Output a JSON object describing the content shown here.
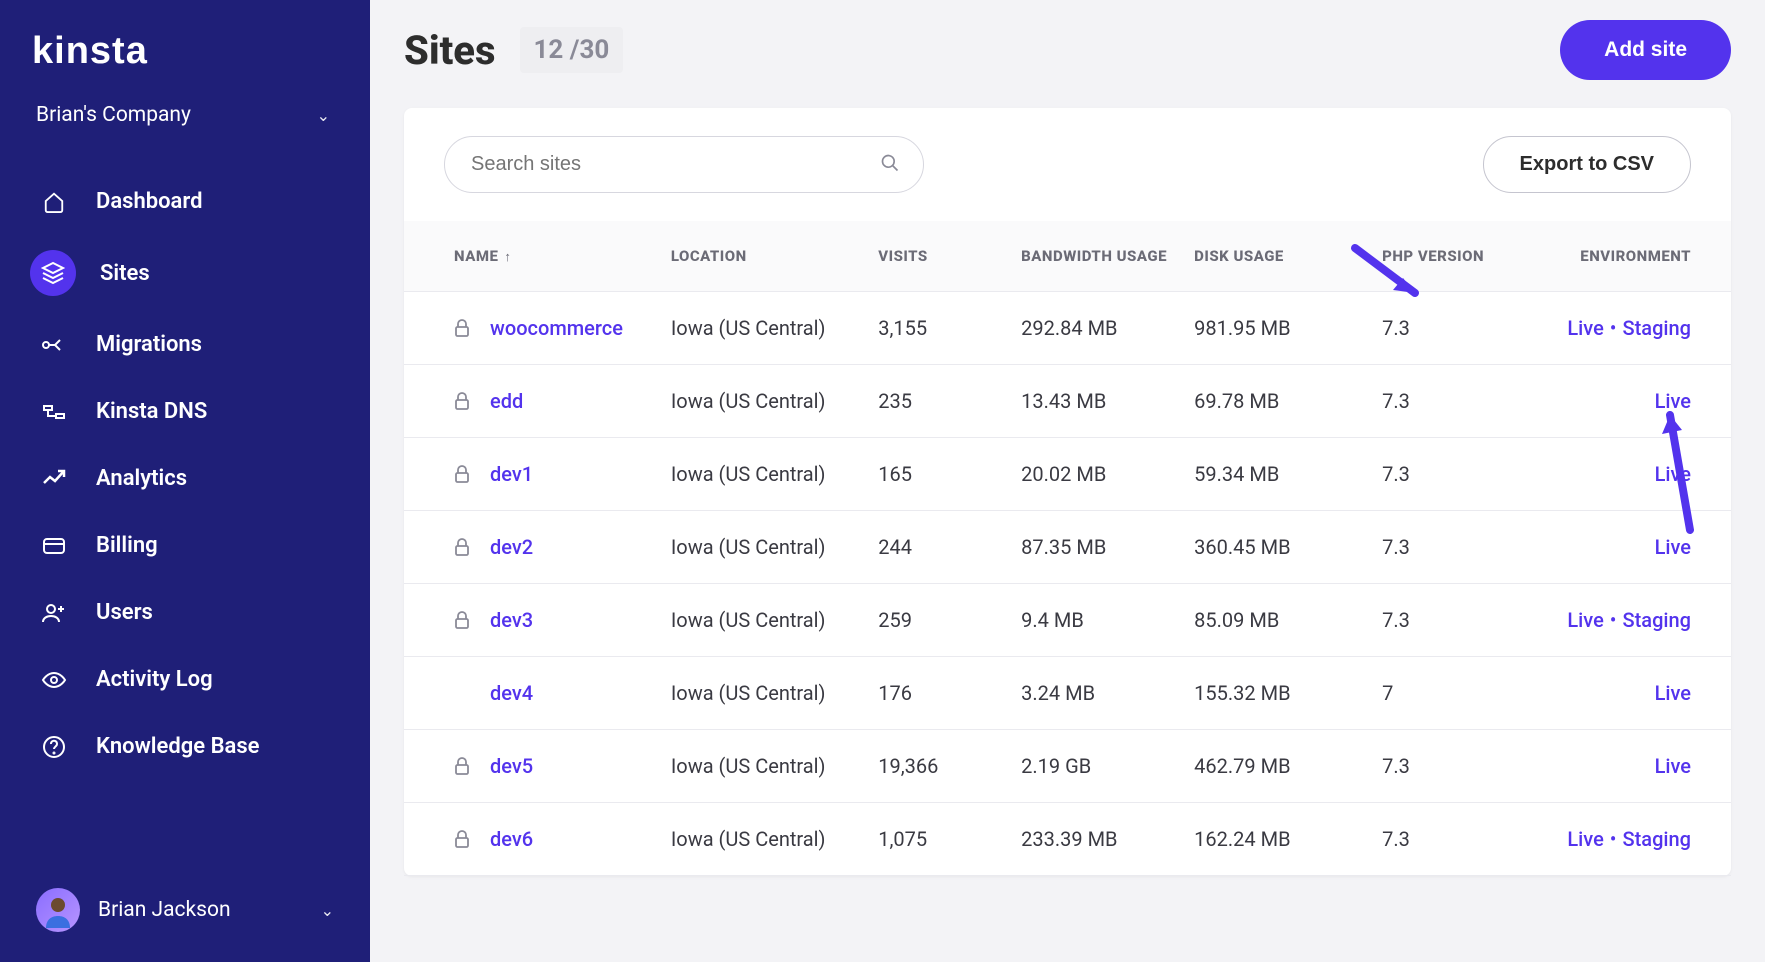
{
  "brand": "KINSTA",
  "company": "Brian's Company",
  "nav": {
    "dashboard": "Dashboard",
    "sites": "Sites",
    "migrations": "Migrations",
    "dns": "Kinsta DNS",
    "analytics": "Analytics",
    "billing": "Billing",
    "users": "Users",
    "activity": "Activity Log",
    "kb": "Knowledge Base"
  },
  "user": "Brian Jackson",
  "page": {
    "title": "Sites",
    "count": "12 /30"
  },
  "buttons": {
    "add_site": "Add site",
    "export": "Export to CSV"
  },
  "search": {
    "placeholder": "Search sites"
  },
  "columns": {
    "name": "NAME",
    "location": "LOCATION",
    "visits": "VISITS",
    "bandwidth": "BANDWIDTH USAGE",
    "disk": "DISK USAGE",
    "php": "PHP VERSION",
    "env": "ENVIRONMENT"
  },
  "env_labels": {
    "live": "Live",
    "staging": "Staging"
  },
  "rows": [
    {
      "locked": true,
      "name": "woocommerce",
      "location": "Iowa (US Central)",
      "visits": "3,155",
      "bandwidth": "292.84 MB",
      "disk": "981.95 MB",
      "php": "7.3",
      "env": [
        "live",
        "staging"
      ]
    },
    {
      "locked": true,
      "name": "edd",
      "location": "Iowa (US Central)",
      "visits": "235",
      "bandwidth": "13.43 MB",
      "disk": "69.78 MB",
      "php": "7.3",
      "env": [
        "live"
      ]
    },
    {
      "locked": true,
      "name": "dev1",
      "location": "Iowa (US Central)",
      "visits": "165",
      "bandwidth": "20.02 MB",
      "disk": "59.34 MB",
      "php": "7.3",
      "env": [
        "live"
      ]
    },
    {
      "locked": true,
      "name": "dev2",
      "location": "Iowa (US Central)",
      "visits": "244",
      "bandwidth": "87.35 MB",
      "disk": "360.45 MB",
      "php": "7.3",
      "env": [
        "live"
      ]
    },
    {
      "locked": true,
      "name": "dev3",
      "location": "Iowa (US Central)",
      "visits": "259",
      "bandwidth": "9.4 MB",
      "disk": "85.09 MB",
      "php": "7.3",
      "env": [
        "live",
        "staging"
      ]
    },
    {
      "locked": false,
      "name": "dev4",
      "location": "Iowa (US Central)",
      "visits": "176",
      "bandwidth": "3.24 MB",
      "disk": "155.32 MB",
      "php": "7",
      "env": [
        "live"
      ]
    },
    {
      "locked": true,
      "name": "dev5",
      "location": "Iowa (US Central)",
      "visits": "19,366",
      "bandwidth": "2.19 GB",
      "disk": "462.79 MB",
      "php": "7.3",
      "env": [
        "live"
      ]
    },
    {
      "locked": true,
      "name": "dev6",
      "location": "Iowa (US Central)",
      "visits": "1,075",
      "bandwidth": "233.39 MB",
      "disk": "162.24 MB",
      "php": "7.3",
      "env": [
        "live",
        "staging"
      ]
    }
  ]
}
